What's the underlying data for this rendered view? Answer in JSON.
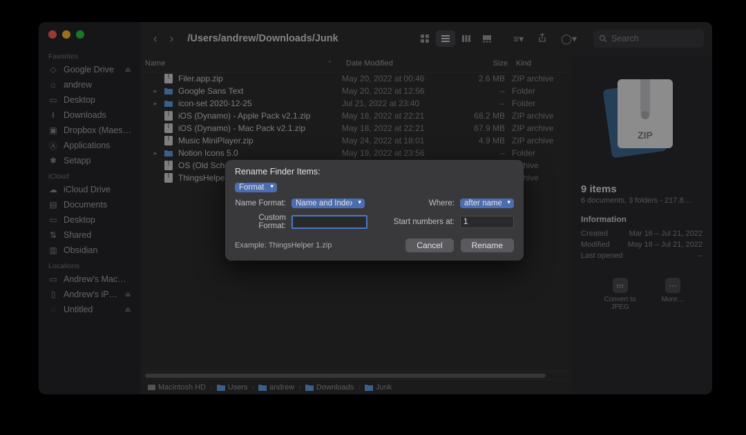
{
  "toolbar": {
    "path": "/Users/andrew/Downloads/Junk",
    "search_placeholder": "Search"
  },
  "sidebar": {
    "sect_favorites": "Favorites",
    "sect_icloud": "iCloud",
    "sect_locations": "Locations",
    "items_fav": [
      {
        "icon": "gdrive",
        "label": "Google Drive",
        "eject": true
      },
      {
        "icon": "home",
        "label": "andrew"
      },
      {
        "icon": "desktop",
        "label": "Desktop"
      },
      {
        "icon": "downloads",
        "label": "Downloads"
      },
      {
        "icon": "dropbox",
        "label": "Dropbox (Maes…"
      },
      {
        "icon": "apps",
        "label": "Applications"
      },
      {
        "icon": "setapp",
        "label": "Setapp"
      }
    ],
    "items_icloud": [
      {
        "icon": "cloud",
        "label": "iCloud Drive"
      },
      {
        "icon": "docs",
        "label": "Documents"
      },
      {
        "icon": "desktop",
        "label": "Desktop"
      },
      {
        "icon": "shared",
        "label": "Shared"
      },
      {
        "icon": "folder",
        "label": "Obsidian"
      }
    ],
    "items_loc": [
      {
        "icon": "laptop",
        "label": "Andrew's MacB…"
      },
      {
        "icon": "phone",
        "label": "Andrew's iP…",
        "eject": true
      },
      {
        "icon": "disk",
        "label": "Untitled",
        "eject": true
      }
    ]
  },
  "columns": {
    "name": "Name",
    "modified": "Date Modified",
    "size": "Size",
    "kind": "Kind"
  },
  "files": [
    {
      "disc": "",
      "type": "zip",
      "name": "Filer.app.zip",
      "mod": "May 20, 2022 at 00:46",
      "size": "2.6 MB",
      "kind": "ZIP archive"
    },
    {
      "disc": "▸",
      "type": "fld",
      "name": "Google Sans Text",
      "mod": "May 20, 2022 at 12:56",
      "size": "--",
      "kind": "Folder"
    },
    {
      "disc": "▸",
      "type": "fld",
      "name": "icon-set 2020-12-25",
      "mod": "Jul 21, 2022 at 23:40",
      "size": "--",
      "kind": "Folder"
    },
    {
      "disc": "",
      "type": "zip",
      "name": "iOS (Dynamo) - Apple Pack v2.1.zip",
      "mod": "May 18, 2022 at 22:21",
      "size": "68.2 MB",
      "kind": "ZIP archive"
    },
    {
      "disc": "",
      "type": "zip",
      "name": "iOS (Dynamo) - Mac Pack v2.1.zip",
      "mod": "May 18, 2022 at 22:21",
      "size": "67.9 MB",
      "kind": "ZIP archive"
    },
    {
      "disc": "",
      "type": "zip",
      "name": "Music MiniPlayer.zip",
      "mod": "May 24, 2022 at 18:01",
      "size": "4.9 MB",
      "kind": "ZIP archive"
    },
    {
      "disc": "▸",
      "type": "fld",
      "name": "Notion Icons 5.0",
      "mod": "May 19, 2022 at 23:56",
      "size": "--",
      "kind": "Folder"
    },
    {
      "disc": "",
      "type": "zip",
      "name": "OS (Old School",
      "mod": "",
      "size": "",
      "kind": "archive"
    },
    {
      "disc": "",
      "type": "zip",
      "name": "ThingsHelper.z",
      "mod": "",
      "size": "",
      "kind": "archive"
    }
  ],
  "pathbar": [
    "Macintosh HD",
    "Users",
    "andrew",
    "Downloads",
    "Junk"
  ],
  "inspector": {
    "title": "9 items",
    "sub": "6 documents, 3 folders - 217.8…",
    "section": "Information",
    "created_k": "Created",
    "created_v": "Mar 16 – Jul 21, 2022",
    "modified_k": "Modified",
    "modified_v": "May 18 – Jul 21, 2022",
    "opened_k": "Last opened",
    "opened_v": "--",
    "act1": "Convert to JPEG",
    "act2": "More…",
    "zip_label": "ZIP"
  },
  "dialog": {
    "title": "Rename Finder Items:",
    "mode": "Format",
    "name_format_lbl": "Name Format:",
    "name_format_val": "Name and Index",
    "where_lbl": "Where:",
    "where_val": "after name",
    "custom_lbl": "Custom Format:",
    "custom_val": "",
    "start_lbl": "Start numbers at:",
    "start_val": "1",
    "example": "Example: ThingsHelper 1.zip",
    "cancel": "Cancel",
    "rename": "Rename"
  }
}
